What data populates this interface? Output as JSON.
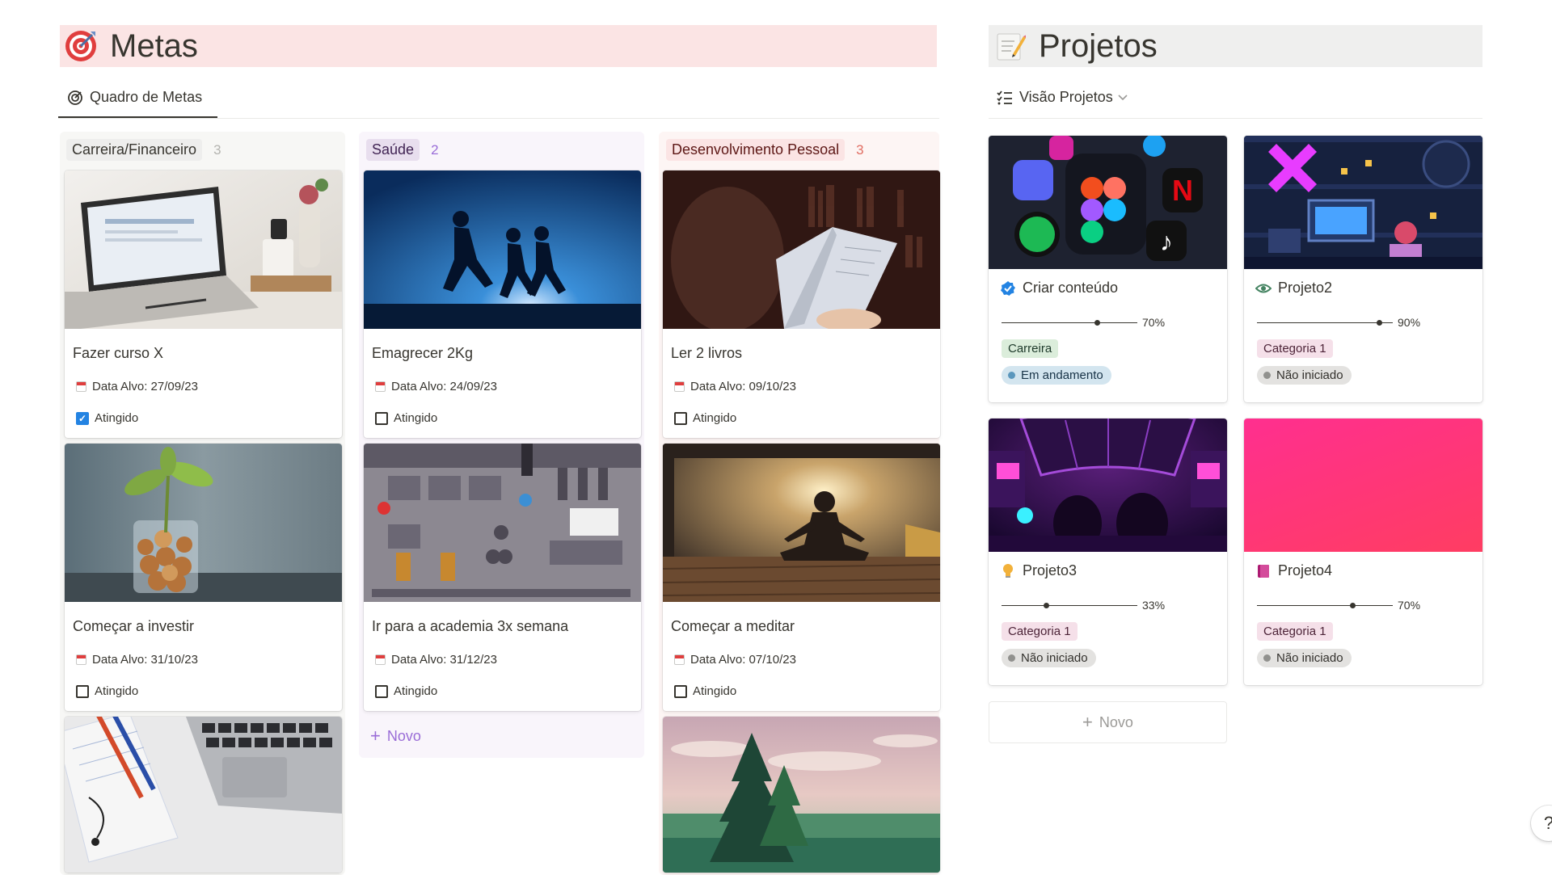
{
  "metas": {
    "title": "Metas",
    "tab_label": "Quadro de Metas",
    "columns": [
      {
        "name": "Carreira/Financeiro",
        "count": "3",
        "tag_bg": "#eeeeed",
        "tag_color": "#37352f",
        "count_color": "#b4b4b0",
        "bg": "#f7f7f5"
      },
      {
        "name": "Saúde",
        "count": "2",
        "tag_bg": "#e8deee",
        "tag_color": "#412454",
        "count_color": "#9a6dd7",
        "bg": "#f9f5fb"
      },
      {
        "name": "Desenvolvimento Pessoal",
        "count": "3",
        "tag_bg": "#fbe4e4",
        "tag_color": "#5d1715",
        "count_color": "#e16f64",
        "bg": "#fdf5f4"
      }
    ],
    "cards": [
      {
        "title": "Fazer curso X",
        "date_label": "Data Alvo: 27/09/23",
        "done_label": "Atingido",
        "done": true,
        "image": "laptop-desk-photo"
      },
      {
        "title": "Emagrecer 2Kg",
        "date_label": "Data Alvo: 24/09/23",
        "done_label": "Atingido",
        "done": false,
        "image": "runners-silhouette-photo"
      },
      {
        "title": "Ler 2 livros",
        "date_label": "Data Alvo: 09/10/23",
        "done_label": "Atingido",
        "done": false,
        "image": "reading-book-photo"
      },
      {
        "title": "Começar a investir",
        "date_label": "Data Alvo: 31/10/23",
        "done_label": "Atingido",
        "done": false,
        "image": "coins-plant-jar-photo"
      },
      {
        "title": "Ir para a academia 3x semana",
        "date_label": "Data Alvo: 31/12/23",
        "done_label": "Atingido",
        "done": false,
        "image": "pixel-gym-illustration"
      },
      {
        "title": "Começar a meditar",
        "date_label": "Data Alvo: 07/10/23",
        "done_label": "Atingido",
        "done": false,
        "image": "meditation-sunset-photo"
      }
    ],
    "new_label": "Novo"
  },
  "projetos": {
    "title": "Projetos",
    "view_label": "Visão Projetos",
    "cards": [
      {
        "title": "Criar conteúdo",
        "progress": 0.7,
        "progress_label": "70%",
        "category": "Carreira",
        "status": "Em andamento",
        "icon": "verified-check-icon",
        "image": "social-apps-3d-icons"
      },
      {
        "title": "Projeto2",
        "progress": 0.9,
        "progress_label": "90%",
        "category": "Categoria 1",
        "status": "Não iniciado",
        "icon": "eye-icon",
        "image": "pixel-art-arcade-room"
      },
      {
        "title": "Projeto3",
        "progress": 0.33,
        "progress_label": "33%",
        "category": "Categoria 1",
        "status": "Não iniciado",
        "icon": "lightbulb-icon",
        "image": "spaceship-cockpit-neon"
      },
      {
        "title": "Projeto4",
        "progress": 0.7,
        "progress_label": "70%",
        "category": "Categoria 1",
        "status": "Não iniciado",
        "icon": "notebook-icon",
        "image": "pink-gradient"
      }
    ],
    "new_label": "Novo"
  },
  "help_label": "?"
}
